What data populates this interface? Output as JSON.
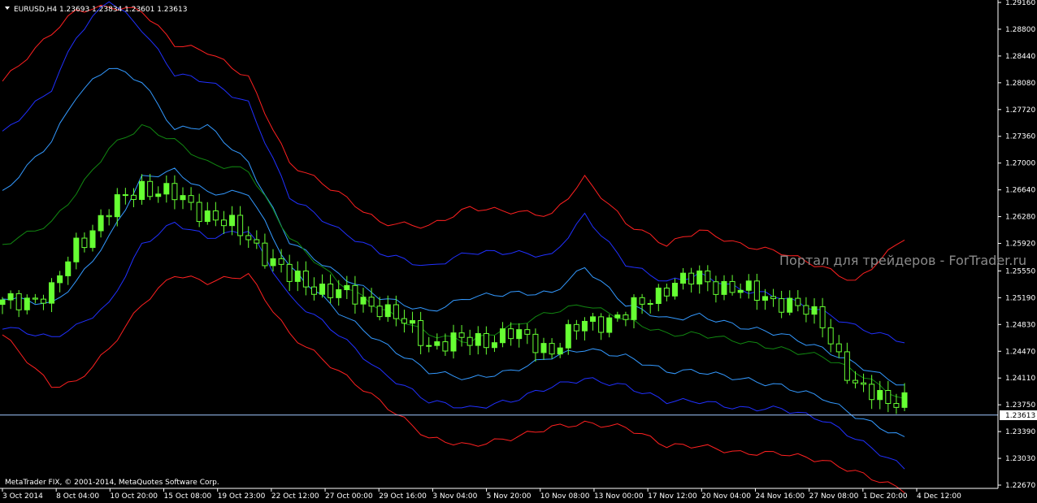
{
  "chart_data": {
    "type": "candlestick",
    "symbol_header": "EURUSD,H4  1.23693 1.23834 1.23601 1.23613",
    "current_price": 1.23613,
    "current_price_label": "1.23613",
    "ylim": [
      1.2267,
      1.2916
    ],
    "y_ticks": [
      {
        "value": 1.2916,
        "label": "1.29160"
      },
      {
        "value": 1.288,
        "label": "1.28800"
      },
      {
        "value": 1.2844,
        "label": "1.28440"
      },
      {
        "value": 1.2808,
        "label": "1.28080"
      },
      {
        "value": 1.2772,
        "label": "1.27720"
      },
      {
        "value": 1.2736,
        "label": "1.27360"
      },
      {
        "value": 1.27,
        "label": "1.27000"
      },
      {
        "value": 1.2664,
        "label": "1.26640"
      },
      {
        "value": 1.2628,
        "label": "1.26280"
      },
      {
        "value": 1.2592,
        "label": "1.25920"
      },
      {
        "value": 1.2555,
        "label": "1.25550"
      },
      {
        "value": 1.2519,
        "label": "1.25190"
      },
      {
        "value": 1.2483,
        "label": "1.24830"
      },
      {
        "value": 1.2447,
        "label": "1.24470"
      },
      {
        "value": 1.2411,
        "label": "1.24110"
      },
      {
        "value": 1.2375,
        "label": "1.23750"
      },
      {
        "value": 1.2339,
        "label": "1.23390"
      },
      {
        "value": 1.2303,
        "label": "1.23030"
      },
      {
        "value": 1.2267,
        "label": "1.22670"
      }
    ],
    "x_ticks": [
      "3 Oct 2014",
      "8 Oct 04:00",
      "10 Oct 20:00",
      "15 Oct 08:00",
      "19 Oct 23:00",
      "22 Oct 12:00",
      "27 Oct 00:00",
      "29 Oct 16:00",
      "3 Nov 04:00",
      "5 Nov 20:00",
      "10 Nov 08:00",
      "13 Nov 00:00",
      "17 Nov 12:00",
      "20 Nov 04:00",
      "24 Nov 16:00",
      "27 Nov 08:00",
      "1 Dec 20:00",
      "4 Dec 12:00"
    ],
    "close_path": [
      [
        0,
        1.251
      ],
      [
        6,
        1.2525
      ],
      [
        9,
        1.259
      ],
      [
        13,
        1.2635
      ],
      [
        17,
        1.267
      ],
      [
        21,
        1.2655
      ],
      [
        25,
        1.2632
      ],
      [
        30,
        1.26
      ],
      [
        35,
        1.2545
      ],
      [
        41,
        1.2525
      ],
      [
        46,
        1.2508
      ],
      [
        52,
        1.2458
      ],
      [
        57,
        1.246
      ],
      [
        62,
        1.247
      ],
      [
        67,
        1.245
      ],
      [
        71,
        1.2485
      ],
      [
        76,
        1.2495
      ],
      [
        81,
        1.2535
      ],
      [
        85,
        1.2545
      ],
      [
        90,
        1.2528
      ],
      [
        95,
        1.2515
      ],
      [
        100,
        1.2488
      ],
      [
        104,
        1.2395
      ],
      [
        110,
        1.238
      ]
    ],
    "bands": [
      {
        "color": "#ff2020",
        "values": [
          1.281,
          1.2875,
          1.2905,
          1.291,
          1.2905,
          1.286,
          1.285,
          1.2815,
          1.27,
          1.266,
          1.262,
          1.2615,
          1.264,
          1.2635,
          1.263,
          1.268,
          1.262,
          1.259,
          1.261,
          1.259,
          1.258,
          1.256,
          1.254,
          1.26
        ]
      },
      {
        "color": "#2030ff",
        "values": [
          1.274,
          1.28,
          1.287,
          1.292,
          1.288,
          1.282,
          1.281,
          1.278,
          1.2655,
          1.261,
          1.258,
          1.256,
          1.258,
          1.258,
          1.2575,
          1.263,
          1.2565,
          1.254,
          1.255,
          1.253,
          1.252,
          1.25,
          1.248,
          1.246
        ]
      },
      {
        "color": "#3399ff",
        "values": [
          1.266,
          1.273,
          1.279,
          1.283,
          1.281,
          1.2745,
          1.275,
          1.27,
          1.2595,
          1.255,
          1.252,
          1.25,
          1.252,
          1.2525,
          1.2525,
          1.256,
          1.251,
          1.249,
          1.2495,
          1.248,
          1.247,
          1.245,
          1.243,
          1.24
        ]
      },
      {
        "color": "#118811",
        "values": [
          1.259,
          1.262,
          1.266,
          1.272,
          1.275,
          1.273,
          1.27,
          1.269,
          1.26,
          1.254,
          1.2505,
          1.247,
          1.246,
          1.248,
          1.25,
          1.251,
          1.249,
          1.247,
          1.247,
          1.246,
          1.245,
          1.244,
          1.242,
          1.238
        ]
      },
      {
        "color": "#3399ff",
        "values": [
          1.252,
          1.251,
          1.254,
          1.26,
          1.268,
          1.269,
          1.266,
          1.266,
          1.256,
          1.25,
          1.246,
          1.242,
          1.241,
          1.242,
          1.244,
          1.245,
          1.244,
          1.242,
          1.242,
          1.241,
          1.24,
          1.2385,
          1.236,
          1.233
        ]
      },
      {
        "color": "#2030ff",
        "values": [
          1.248,
          1.2465,
          1.248,
          1.251,
          1.259,
          1.262,
          1.26,
          1.261,
          1.252,
          1.247,
          1.242,
          1.238,
          1.237,
          1.238,
          1.24,
          1.241,
          1.24,
          1.238,
          1.238,
          1.237,
          1.237,
          1.2355,
          1.233,
          1.229
        ]
      },
      {
        "color": "#ff2020",
        "values": [
          1.247,
          1.24,
          1.2405,
          1.245,
          1.251,
          1.255,
          1.254,
          1.255,
          1.247,
          1.242,
          1.238,
          1.233,
          1.232,
          1.233,
          1.2345,
          1.235,
          1.2345,
          1.232,
          1.232,
          1.231,
          1.231,
          1.23,
          1.2285,
          1.226
        ]
      }
    ],
    "bands_legend": "",
    "grid": false
  },
  "watermark": "Портал для трейдеров - ForTrader.ru",
  "copyright": "MetaTrader FIX, © 2001-2014, MetaQuotes Software Corp.",
  "colors": {
    "background": "#000000",
    "bull_candle": "#66ff33",
    "bear_candle": "#00aa00",
    "axis": "#ffffff",
    "price_line": "#a0c8ff"
  }
}
